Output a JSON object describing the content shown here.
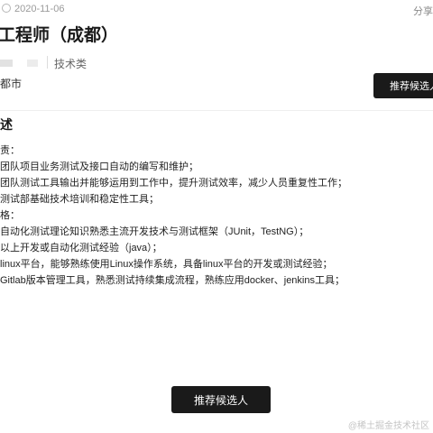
{
  "header": {
    "date": "2020-11-06",
    "share_label": "分享",
    "title": "工程师（成都）"
  },
  "job_meta": {
    "category": "技术类",
    "city": "都市",
    "recommend_button": "推荐候选人"
  },
  "description": {
    "section_title": "述",
    "lines": [
      "责：",
      "团队项目业务测试及接口自动的编写和维护；",
      "团队测试工具输出并能够运用到工作中，提升测试效率，减少人员重复性工作；",
      "测试部基础技术培训和稳定性工具；",
      "格：",
      "自动化测试理论知识熟悉主流开发技术与测试框架（JUnit，TestNG）；",
      "以上开发或自动化测试经验（java）；",
      "linux平台，能够熟练使用Linux操作系统，具备linux平台的开发或测试经验；",
      "Gitlab版本管理工具，熟悉测试持续集成流程，熟练应用docker、jenkins工具；"
    ]
  },
  "footer": {
    "recommend_button": "推荐候选人",
    "watermark": "@稀土掘金技术社区"
  }
}
